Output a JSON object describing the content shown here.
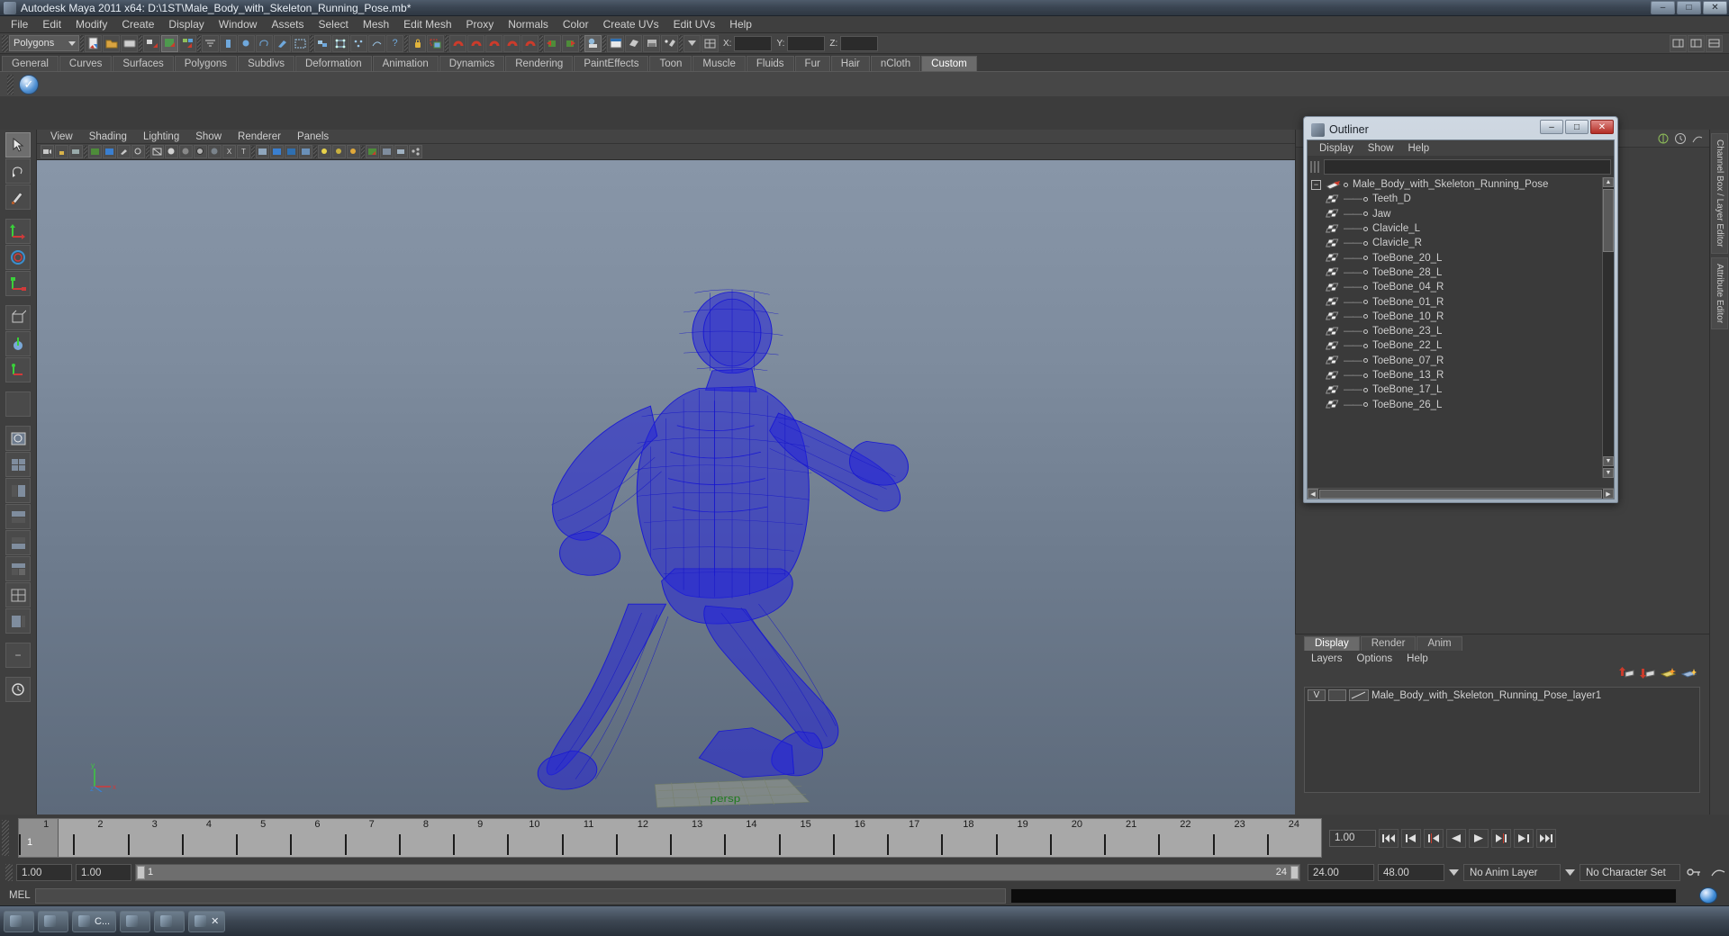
{
  "window": {
    "title": "Autodesk Maya 2011 x64: D:\\1ST\\Male_Body_with_Skeleton_Running_Pose.mb*",
    "icon": "maya-icon",
    "buttons": {
      "minimize": "–",
      "maximize": "□",
      "close": "✕"
    }
  },
  "menubar": {
    "items": [
      "File",
      "Edit",
      "Modify",
      "Create",
      "Display",
      "Window",
      "Assets",
      "Select",
      "Mesh",
      "Edit Mesh",
      "Proxy",
      "Normals",
      "Color",
      "Create UVs",
      "Edit UVs",
      "Help"
    ]
  },
  "toolbar": {
    "mode_selected": "Polygons",
    "axis_labels": {
      "x": "X:",
      "y": "Y:",
      "z": "Z:"
    },
    "axis_values": {
      "x": "",
      "y": "",
      "z": ""
    }
  },
  "shelf": {
    "tabs": [
      "General",
      "Curves",
      "Surfaces",
      "Polygons",
      "Subdivs",
      "Deformation",
      "Animation",
      "Dynamics",
      "Rendering",
      "PaintEffects",
      "Toon",
      "Muscle",
      "Fluids",
      "Fur",
      "Hair",
      "nCloth",
      "Custom"
    ],
    "active_tab": "Custom",
    "item_icon": "checkmark-shelf-icon"
  },
  "viewport": {
    "menus": [
      "View",
      "Shading",
      "Lighting",
      "Show",
      "Renderer",
      "Panels"
    ],
    "gnomon": {
      "y": "y",
      "x": "x",
      "z": "z"
    },
    "model_color": "#1a1ad2",
    "bg_top": "#8896a8",
    "bg_bottom": "#5d6a7b"
  },
  "right_rail": {
    "tabs": [
      "Channel Box / Layer Editor",
      "Attribute Editor"
    ]
  },
  "outliner": {
    "title": "Outliner",
    "icon": "maya-icon",
    "buttons": {
      "minimize": "–",
      "maximize": "□",
      "close": "✕"
    },
    "menus": [
      "Display",
      "Show",
      "Help"
    ],
    "search_value": "",
    "root": {
      "label": "Male_Body_with_Skeleton_Running_Pose",
      "expander": "−"
    },
    "items": [
      "Teeth_D",
      "Jaw",
      "Clavicle_L",
      "Clavicle_R",
      "ToeBone_20_L",
      "ToeBone_28_L",
      "ToeBone_04_R",
      "ToeBone_01_R",
      "ToeBone_10_R",
      "ToeBone_23_L",
      "ToeBone_22_L",
      "ToeBone_07_R",
      "ToeBone_13_R",
      "ToeBone_17_L",
      "ToeBone_26_L"
    ]
  },
  "layer_editor": {
    "tabs": [
      "Display",
      "Render",
      "Anim"
    ],
    "active_tab": "Display",
    "menus": [
      "Layers",
      "Options",
      "Help"
    ],
    "buttons": [
      "layer-up-icon",
      "layer-down-icon",
      "new-layer-icon",
      "new-layer-from-selected-icon"
    ],
    "layers": [
      {
        "visibility": "V",
        "state": "",
        "name": "Male_Body_with_Skeleton_Running_Pose_layer1"
      }
    ]
  },
  "timeline": {
    "ticks": [
      "1",
      "2",
      "3",
      "4",
      "5",
      "6",
      "7",
      "8",
      "9",
      "10",
      "11",
      "12",
      "13",
      "14",
      "15",
      "16",
      "17",
      "18",
      "19",
      "20",
      "21",
      "22",
      "23",
      "24"
    ],
    "current_frame": "1",
    "playback_speed": "1.00",
    "transport": [
      "go-to-start-icon",
      "step-back-keyframe-icon",
      "step-back-frame-icon",
      "play-backwards-icon",
      "play-forwards-icon",
      "step-forward-frame-icon",
      "step-forward-keyframe-icon",
      "go-to-end-icon"
    ]
  },
  "range_slider": {
    "anim_start": "1.00",
    "range_start": "1.00",
    "bar_start": "1",
    "bar_end": "24",
    "range_end": "24.00",
    "anim_end": "48.00",
    "anim_layer": "No Anim Layer",
    "character_set": "No Character Set",
    "auto_key_icon": "key-icon",
    "anim_prefs_icon": "animation-preferences-icon"
  },
  "command_line": {
    "label": "MEL",
    "input_value": "",
    "output_value": "",
    "help_icon": "help-icon"
  },
  "taskbar": {
    "items": [
      {
        "label": "",
        "icon": "start-icon"
      },
      {
        "label": "",
        "icon": "window-icon"
      },
      {
        "label": "C...",
        "icon": "maya-taskbar-icon"
      },
      {
        "label": "",
        "icon": "restore-icon"
      },
      {
        "label": "",
        "icon": "maximize-icon"
      },
      {
        "label": "✕",
        "icon": "close-icon"
      }
    ]
  }
}
